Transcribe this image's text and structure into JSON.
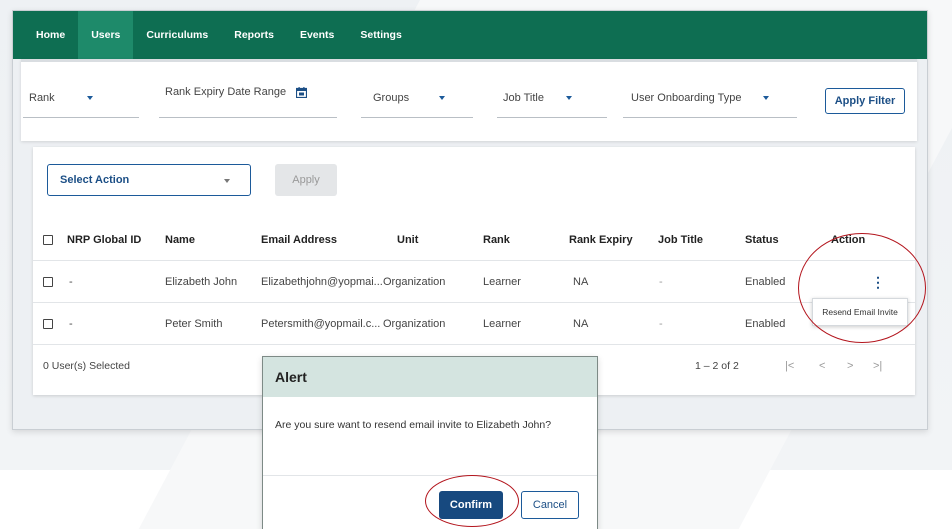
{
  "nav": {
    "items": [
      {
        "label": "Home",
        "active": false
      },
      {
        "label": "Users",
        "active": true
      },
      {
        "label": "Curriculums",
        "active": false
      },
      {
        "label": "Reports",
        "active": false
      },
      {
        "label": "Events",
        "active": false
      },
      {
        "label": "Settings",
        "active": false
      }
    ]
  },
  "filters": {
    "rank": "Rank",
    "rank_expiry": "Rank Expiry Date Range",
    "groups": "Groups",
    "job_title": "Job Title",
    "onboarding": "User Onboarding Type",
    "apply_label": "Apply Filter"
  },
  "actions": {
    "select_action": "Select Action",
    "apply": "Apply"
  },
  "table": {
    "headers": [
      "NRP Global ID",
      "Name",
      "Email Address",
      "Unit",
      "Rank",
      "Rank Expiry",
      "Job Title",
      "Status",
      "Action"
    ],
    "rows": [
      {
        "id": "-",
        "name": "Elizabeth John",
        "email": "Elizabethjohn@yopmai...",
        "unit": "Organization",
        "rank": "Learner",
        "rank_expiry": "NA",
        "job_title": "-",
        "status": "Enabled"
      },
      {
        "id": "-",
        "name": "Peter Smith",
        "email": "Petersmith@yopmail.c...",
        "unit": "Organization",
        "rank": "Learner",
        "rank_expiry": "NA",
        "job_title": "-",
        "status": "Enabled"
      }
    ],
    "selected_count": "0 User(s) Selected",
    "pagination": "1 – 2 of 2"
  },
  "tooltip": {
    "text": "Resend Email Invite"
  },
  "modal": {
    "title": "Alert",
    "message": "Are you sure want to resend email invite to Elizabeth John?",
    "confirm": "Confirm",
    "cancel": "Cancel"
  },
  "colors": {
    "nav_bg": "#0e6e52",
    "primary_blue": "#17497f",
    "highlight_red": "#b3151d",
    "modal_header": "#d4e4e0"
  }
}
